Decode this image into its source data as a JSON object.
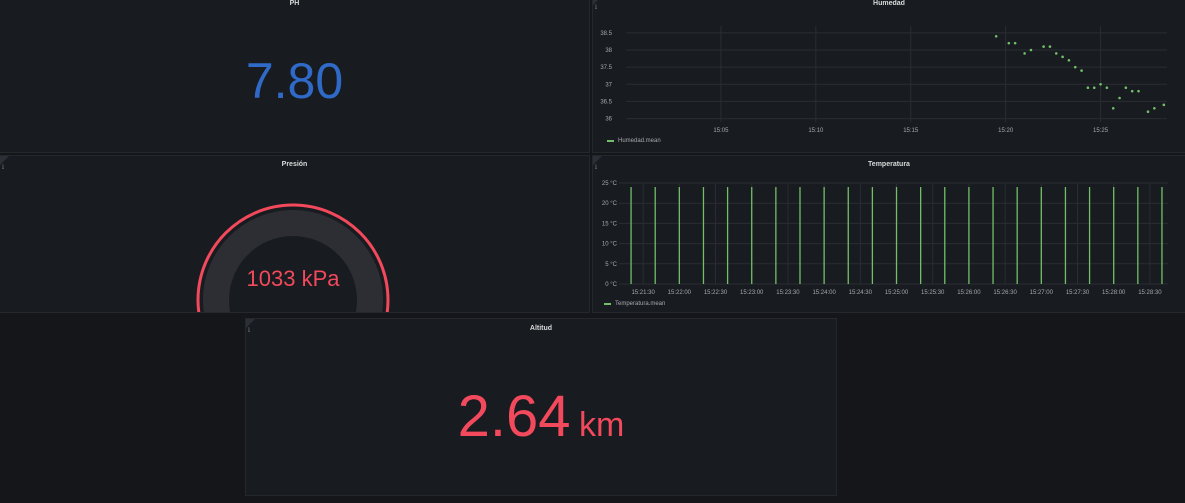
{
  "colors": {
    "ph_value": "#2f6ac8",
    "red": "#f2495c",
    "series_green": "#73bf69",
    "gauge_track": "#2c2e33",
    "grid": "#2a2d33",
    "tick_text": "#a6a8ad"
  },
  "icons": {
    "info": "info-icon"
  },
  "panels": {
    "ph": {
      "title": "PH",
      "value": "7.80"
    },
    "humedad": {
      "title": "Humedad",
      "legend": "Humedad.mean",
      "chart_data": {
        "type": "scatter",
        "x_tick_labels": [
          "15:05",
          "15:10",
          "15:15",
          "15:20",
          "15:25"
        ],
        "y_tick_labels": [
          "38.5",
          "38",
          "37.5",
          "37",
          "36.5",
          "36"
        ],
        "ylim": [
          35.9,
          38.7
        ],
        "xlim_minutes": [
          "15:00",
          "15:28:30"
        ],
        "grid": true,
        "legend_position": "bottom-left",
        "series": [
          {
            "name": "Humedad.mean",
            "points": [
              {
                "x": "15:19:30",
                "y": 38.4
              },
              {
                "x": "15:20:10",
                "y": 38.2
              },
              {
                "x": "15:20:30",
                "y": 38.2
              },
              {
                "x": "15:21:00",
                "y": 37.9
              },
              {
                "x": "15:21:20",
                "y": 38.0
              },
              {
                "x": "15:22:00",
                "y": 38.1
              },
              {
                "x": "15:22:20",
                "y": 38.1
              },
              {
                "x": "15:22:40",
                "y": 37.9
              },
              {
                "x": "15:23:00",
                "y": 37.8
              },
              {
                "x": "15:23:20",
                "y": 37.7
              },
              {
                "x": "15:23:40",
                "y": 37.5
              },
              {
                "x": "15:24:00",
                "y": 37.4
              },
              {
                "x": "15:24:20",
                "y": 36.9
              },
              {
                "x": "15:24:40",
                "y": 36.9
              },
              {
                "x": "15:25:00",
                "y": 37.0
              },
              {
                "x": "15:25:20",
                "y": 36.9
              },
              {
                "x": "15:25:40",
                "y": 36.3
              },
              {
                "x": "15:26:00",
                "y": 36.6
              },
              {
                "x": "15:26:20",
                "y": 36.9
              },
              {
                "x": "15:26:40",
                "y": 36.8
              },
              {
                "x": "15:27:00",
                "y": 36.8
              },
              {
                "x": "15:27:30",
                "y": 36.2
              },
              {
                "x": "15:27:50",
                "y": 36.3
              },
              {
                "x": "15:28:20",
                "y": 36.4
              }
            ]
          }
        ]
      }
    },
    "presion": {
      "title": "Presión",
      "value": "1033 kPa",
      "chart_data": {
        "type": "gauge",
        "value_fraction": 0.1
      }
    },
    "temperatura": {
      "title": "Temperatura",
      "legend": "Temperatura.mean",
      "chart_data": {
        "type": "bar",
        "x_tick_labels": [
          "15:21:30",
          "15:22:00",
          "15:22:30",
          "15:23:00",
          "15:23:30",
          "15:24:00",
          "15:24:30",
          "15:25:00",
          "15:25:30",
          "15:26:00",
          "15:26:30",
          "15:27:00",
          "15:27:30",
          "15:28:00",
          "15:28:30"
        ],
        "y_tick_labels": [
          "25 °C",
          "20 °C",
          "15 °C",
          "10 °C",
          "5 °C",
          "0 °C"
        ],
        "ylim": [
          0,
          25
        ],
        "grid": true,
        "legend_position": "bottom-left",
        "series": [
          {
            "name": "Temperatura.mean",
            "times": [
              "15:21:20",
              "15:21:40",
              "15:22:00",
              "15:22:20",
              "15:22:40",
              "15:23:00",
              "15:23:20",
              "15:23:40",
              "15:24:00",
              "15:24:20",
              "15:24:40",
              "15:25:00",
              "15:25:20",
              "15:25:40",
              "15:26:00",
              "15:26:20",
              "15:26:40",
              "15:27:00",
              "15:27:20",
              "15:27:40",
              "15:28:00",
              "15:28:20",
              "15:28:40"
            ],
            "values": [
              24,
              24,
              24,
              24,
              24,
              24,
              24,
              24,
              24,
              24,
              24,
              24,
              24,
              24,
              24,
              24,
              24,
              24,
              24,
              24,
              24,
              24,
              24
            ]
          }
        ]
      }
    },
    "altitud": {
      "title": "Altitud",
      "value": "2.64",
      "unit": "km"
    }
  }
}
